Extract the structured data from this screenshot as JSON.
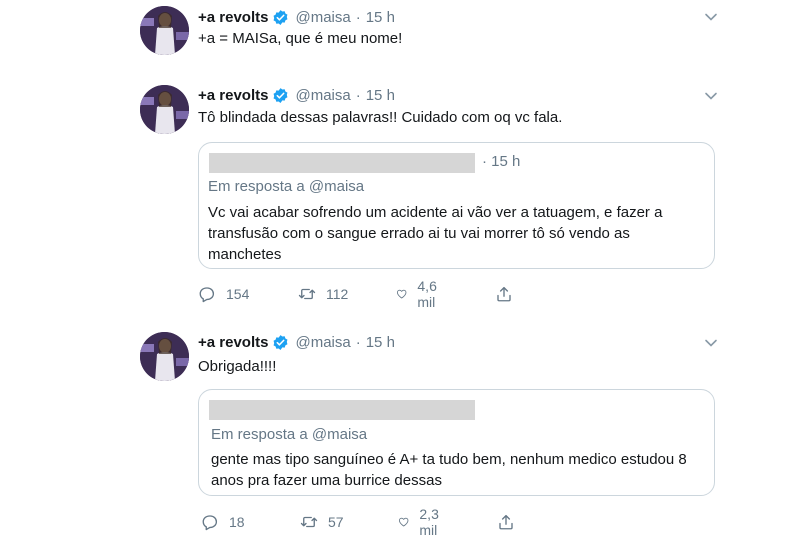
{
  "colors": {
    "verified": "#1da1f2",
    "secondary_text": "#657786",
    "border": "#ccd6dd",
    "redaction": "#d6d6d6"
  },
  "icons": {
    "verified": "verified-badge-icon",
    "caret": "chevron-down-icon",
    "reply": "reply-icon",
    "retweet": "retweet-icon",
    "like": "heart-icon",
    "share": "share-icon"
  },
  "tweets": [
    {
      "author": {
        "name": "+a revolts",
        "handle": "@maisa"
      },
      "separator": "·",
      "time": "15 h",
      "text": "+a = MAISa, que é meu nome!"
    },
    {
      "author": {
        "name": "+a revolts",
        "handle": "@maisa"
      },
      "separator": "·",
      "time": "15 h",
      "text": "Tô blindada dessas palavras!! Cuidado com oq vc fala.",
      "quote": {
        "time": "· 15 h",
        "reply_prefix": "Em resposta a",
        "reply_handle": "@maisa",
        "text": "Vc vai acabar sofrendo um acidente ai vão ver a tatuagem, e fazer a transfusão com o sangue errado ai tu vai morrer tô só vendo as manchetes"
      },
      "actions": {
        "replies": "154",
        "retweets": "112",
        "likes": "4,6 mil"
      }
    },
    {
      "author": {
        "name": "+a revolts",
        "handle": "@maisa"
      },
      "separator": "·",
      "time": "15 h",
      "text": "Obrigada!!!!",
      "quote": {
        "reply_prefix": "Em resposta a",
        "reply_handle": "@maisa",
        "text": "gente mas tipo sanguíneo é A+ ta tudo bem, nenhum medico estudou 8 anos pra fazer uma burrice dessas"
      },
      "actions": {
        "replies": "18",
        "retweets": "57",
        "likes": "2,3 mil"
      }
    }
  ]
}
